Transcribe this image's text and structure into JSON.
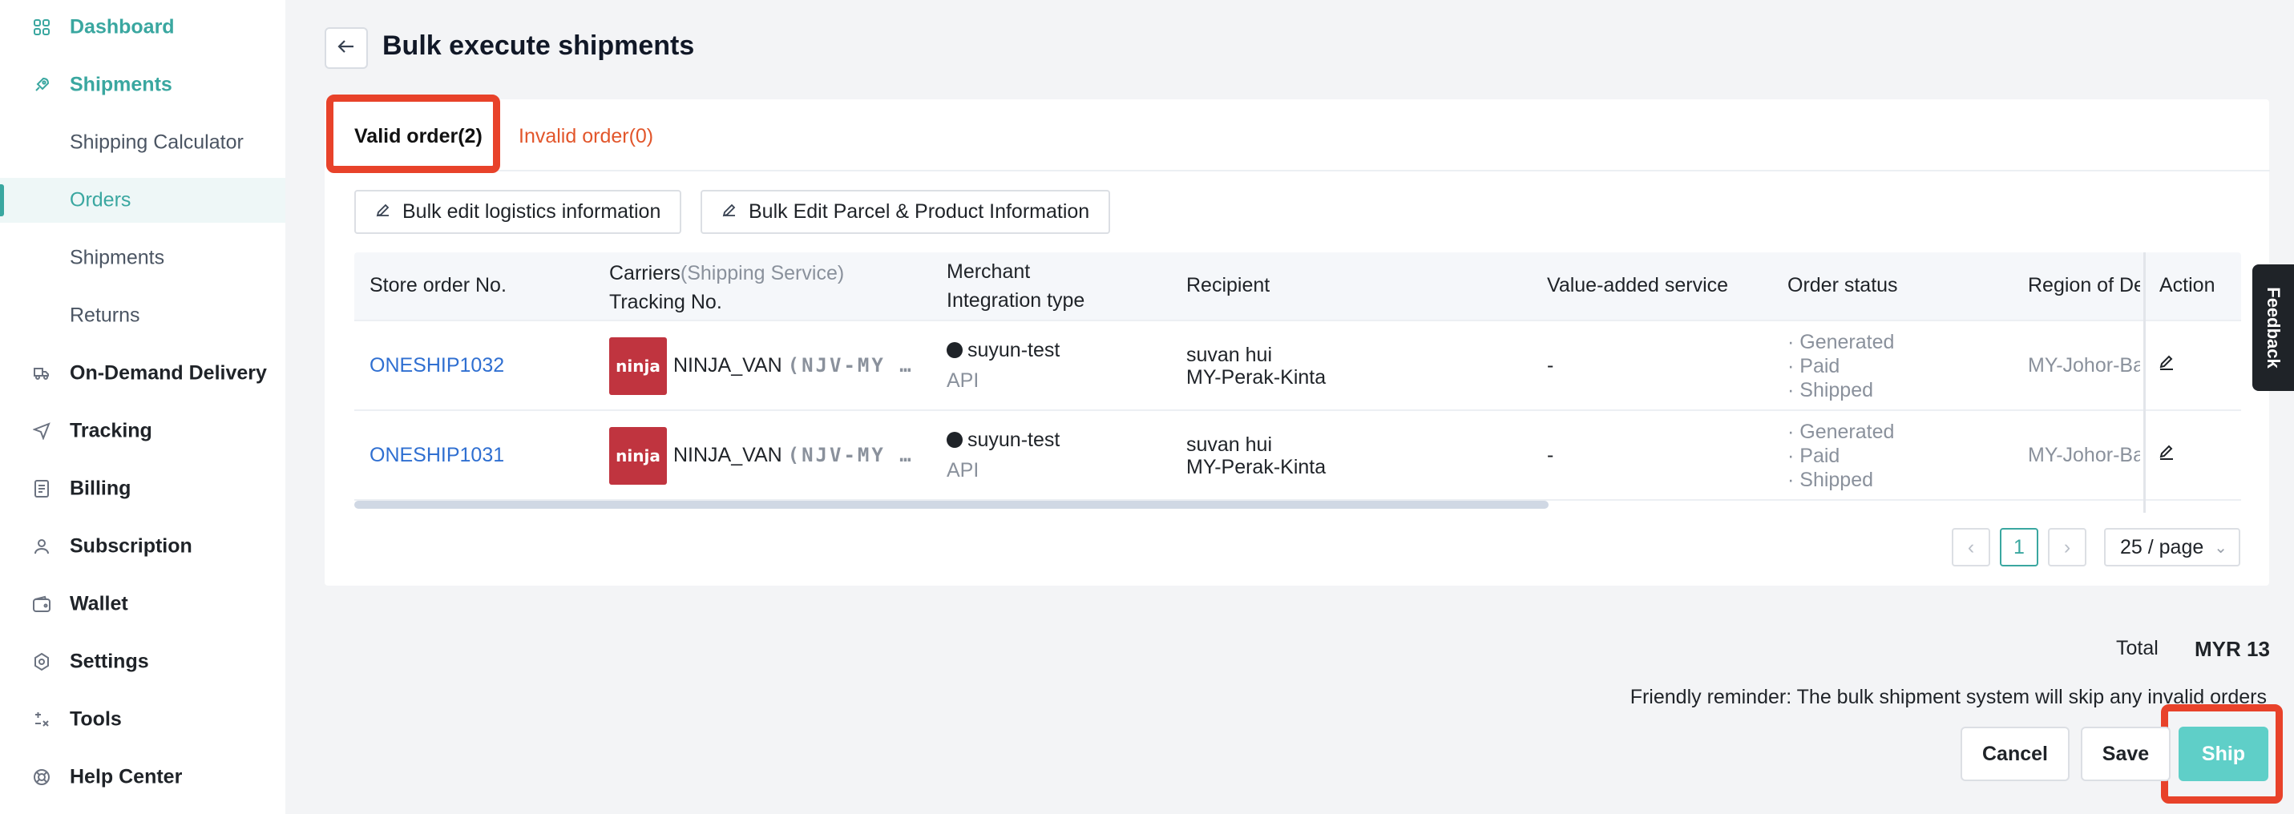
{
  "sidebar": {
    "items": [
      {
        "label": "Dashboard",
        "icon": "grid-icon"
      },
      {
        "label": "Shipments",
        "icon": "rocket-icon"
      },
      {
        "label": "Shipping Calculator"
      },
      {
        "label": "Orders"
      },
      {
        "label": "Shipments"
      },
      {
        "label": "Returns"
      },
      {
        "label": "On-Demand Delivery",
        "icon": "delivery-icon"
      },
      {
        "label": "Tracking",
        "icon": "send-icon"
      },
      {
        "label": "Billing",
        "icon": "bill-icon"
      },
      {
        "label": "Subscription",
        "icon": "user-icon"
      },
      {
        "label": "Wallet",
        "icon": "wallet-icon"
      },
      {
        "label": "Settings",
        "icon": "gear-icon"
      },
      {
        "label": "Tools",
        "icon": "tools-icon"
      },
      {
        "label": "Help Center",
        "icon": "help-icon"
      }
    ]
  },
  "header": {
    "title": "Bulk execute shipments"
  },
  "tabs": {
    "valid": "Valid order(2)",
    "invalid": "Invalid order(0)"
  },
  "toolbar": {
    "bulk_logistics": "Bulk edit logistics information",
    "bulk_parcel": "Bulk Edit Parcel & Product Information"
  },
  "table": {
    "headers": {
      "store_order": "Store order No.",
      "carriers": "Carriers",
      "shipping_service": "(Shipping Service)",
      "tracking": "Tracking No.",
      "merchant": "Merchant",
      "integration": "Integration type",
      "recipient": "Recipient",
      "vas": "Value-added service",
      "status": "Order status",
      "region": "Region of De",
      "action": "Action"
    },
    "rows": [
      {
        "order": "ONESHIP1032",
        "carrier": "NINJA_VAN",
        "service": "(NJV-MY …",
        "logo_text": "ninja",
        "merchant": "suyun-test",
        "integration": "API",
        "recipient_name": "suvan hui",
        "recipient_region": "MY-Perak-Kinta",
        "vas": "-",
        "status": [
          "· Generated",
          "· Paid",
          "· Shipped"
        ],
        "region": "MY-Johor-Ba"
      },
      {
        "order": "ONESHIP1031",
        "carrier": "NINJA_VAN",
        "service": "(NJV-MY …",
        "logo_text": "ninja",
        "merchant": "suyun-test",
        "integration": "API",
        "recipient_name": "suvan hui",
        "recipient_region": "MY-Perak-Kinta",
        "vas": "-",
        "status": [
          "· Generated",
          "· Paid",
          "· Shipped"
        ],
        "region": "MY-Johor-Ba"
      }
    ]
  },
  "pagination": {
    "current": "1",
    "page_size": "25 / page"
  },
  "footer": {
    "total_label": "Total",
    "total_value": "MYR 13",
    "reminder": "Friendly reminder: The bulk shipment system will skip any invalid orders",
    "cancel": "Cancel",
    "save": "Save",
    "ship": "Ship"
  },
  "feedback": "Feedback",
  "colors": {
    "accent": "#3aa7a0",
    "highlight": "#e8422a",
    "link": "#2f6fd1",
    "invalid": "#e2562b",
    "ship": "#5fcfc8"
  }
}
